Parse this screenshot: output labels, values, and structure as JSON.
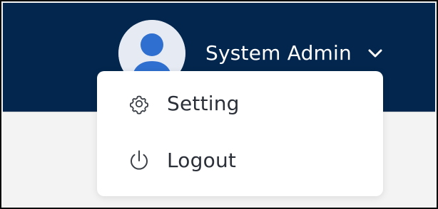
{
  "header": {
    "background_color": "#02264d",
    "user": {
      "name": "System Admin",
      "avatar_icon": "user-avatar-icon",
      "avatar_color": "#2f6fcf"
    },
    "dropdown_icon": "chevron-down-icon"
  },
  "dropdown": {
    "items": [
      {
        "label": "Setting",
        "icon": "gear-icon"
      },
      {
        "label": "Logout",
        "icon": "power-icon"
      }
    ]
  }
}
